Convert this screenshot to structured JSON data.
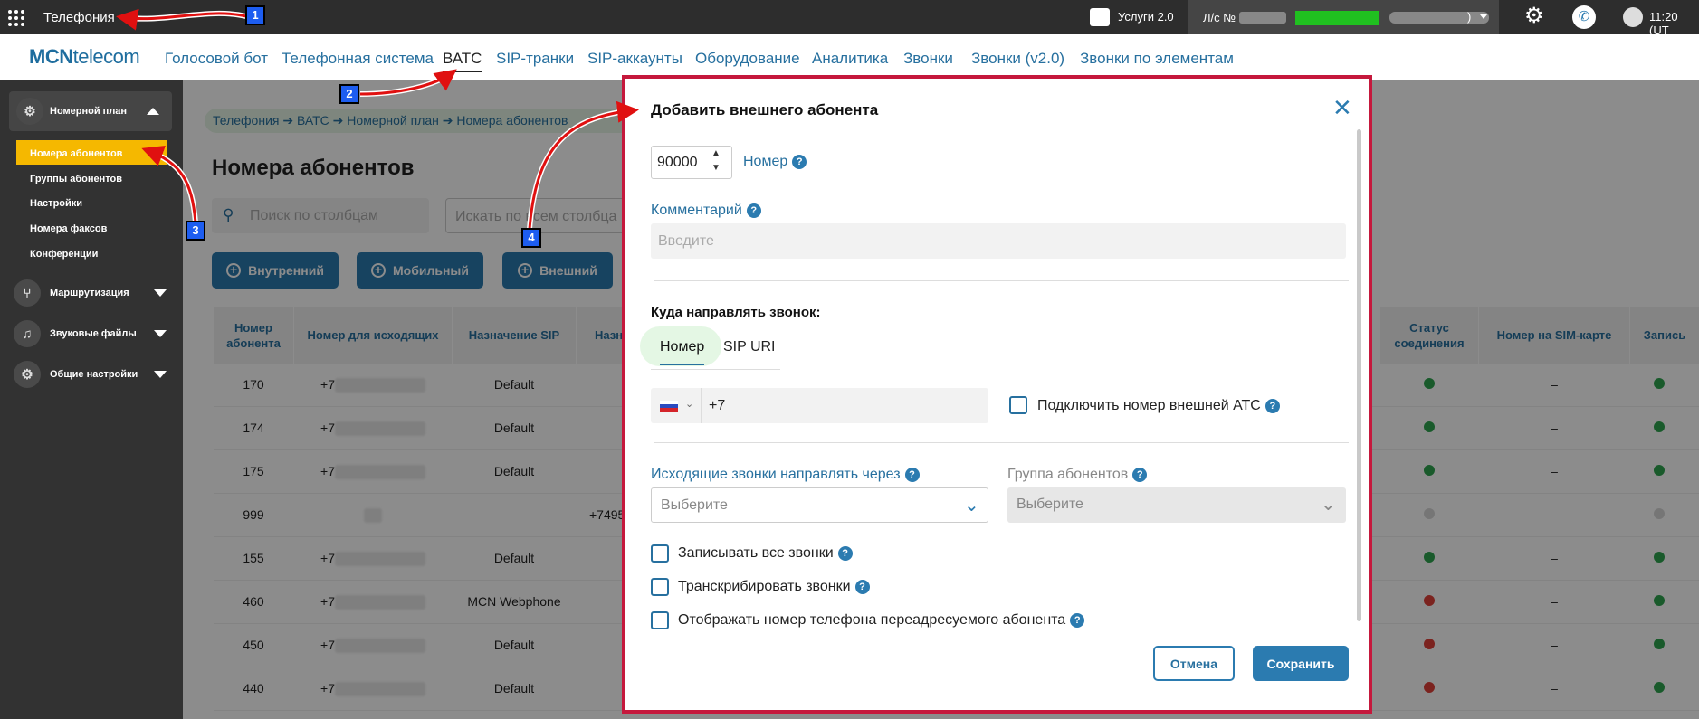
{
  "topbar": {
    "app_title": "Телефония",
    "services": "Услуги 2.0",
    "account_prefix": "Л/с №",
    "account_suffix": ")",
    "time": "11:20 (UT"
  },
  "brand": {
    "logo_a": "MCN",
    "logo_b": "telecom"
  },
  "nav": {
    "items": [
      "Голосовой бот",
      "Телефонная система",
      "ВАТС",
      "SIP-транки",
      "SIP-аккаунты",
      "Оборудование",
      "Аналитика",
      "Звонки",
      "Звонки (v2.0)",
      "Звонки по элементам"
    ]
  },
  "sidebar": {
    "sections": [
      {
        "label": "Номерной план"
      },
      {
        "label": "Маршрутизация"
      },
      {
        "label": "Звуковые файлы"
      },
      {
        "label": "Общие настройки"
      }
    ],
    "subitems": [
      "Номера абонентов",
      "Группы абонентов",
      "Настройки",
      "Номера факсов",
      "Конференции"
    ]
  },
  "breadcrumb": [
    "Телефония",
    "ВАТС",
    "Номерной план",
    "Номера абонентов"
  ],
  "page": {
    "title": "Номера абонентов",
    "search_placeholder": "Поиск по столбцам",
    "search_all_placeholder": "Искать по всем столбца"
  },
  "actions": {
    "internal": "Внутренний",
    "mobile": "Мобильный",
    "external": "Внешний"
  },
  "table": {
    "headers": [
      "Номер абонента",
      "Номер для исходящих",
      "Назначение SIP",
      "Назн",
      "Статус соединения",
      "Номер на SIM-карте",
      "Запись"
    ],
    "rows": [
      {
        "num": "170",
        "out": "+7",
        "sip": "Default",
        "n": "",
        "status": "#2ea44f",
        "sim": "–",
        "rec": "#2ea44f"
      },
      {
        "num": "174",
        "out": "+7",
        "sip": "Default",
        "n": "",
        "status": "#2ea44f",
        "sim": "–",
        "rec": "#2ea44f"
      },
      {
        "num": "175",
        "out": "+7",
        "sip": "Default",
        "n": "",
        "status": "#2ea44f",
        "sim": "–",
        "rec": "#2ea44f"
      },
      {
        "num": "999",
        "out": "",
        "sip": "–",
        "n": "+7495",
        "status": "#d8d8d8",
        "sim": "–",
        "rec": "#d8d8d8"
      },
      {
        "num": "155",
        "out": "+7",
        "sip": "Default",
        "n": "",
        "status": "#2ea44f",
        "sim": "–",
        "rec": "#2ea44f"
      },
      {
        "num": "460",
        "out": "+7",
        "sip": "MCN Webphone",
        "n": "",
        "status": "#e0403a",
        "sim": "–",
        "rec": "#2ea44f"
      },
      {
        "num": "450",
        "out": "+7",
        "sip": "Default",
        "n": "",
        "status": "#e0403a",
        "sim": "–",
        "rec": "#2ea44f"
      },
      {
        "num": "440",
        "out": "+7",
        "sip": "Default",
        "n": "",
        "status": "#e0403a",
        "sim": "–",
        "rec": "#2ea44f"
      }
    ]
  },
  "modal": {
    "title": "Добавить внешнего абонента",
    "number_value": "90000",
    "number_label": "Номер",
    "comment_label": "Комментарий",
    "comment_placeholder": "Введите",
    "route_title": "Куда направлять звонок:",
    "tab_number": "Номер",
    "tab_sip": "SIP URI",
    "phone_value": "+7",
    "connect_pbx": "Подключить номер внешней АТС",
    "outgoing_label": "Исходящие звонки направлять через",
    "outgoing_placeholder": "Выберите",
    "group_label": "Группа абонентов",
    "group_placeholder": "Выберите",
    "cb_record": "Записывать все звонки",
    "cb_transcribe": "Транскрибировать звонки",
    "cb_show": "Отображать номер телефона переадресуемого абонента",
    "cancel": "Отмена",
    "save": "Сохранить"
  },
  "annotations": [
    "1",
    "2",
    "3",
    "4"
  ]
}
